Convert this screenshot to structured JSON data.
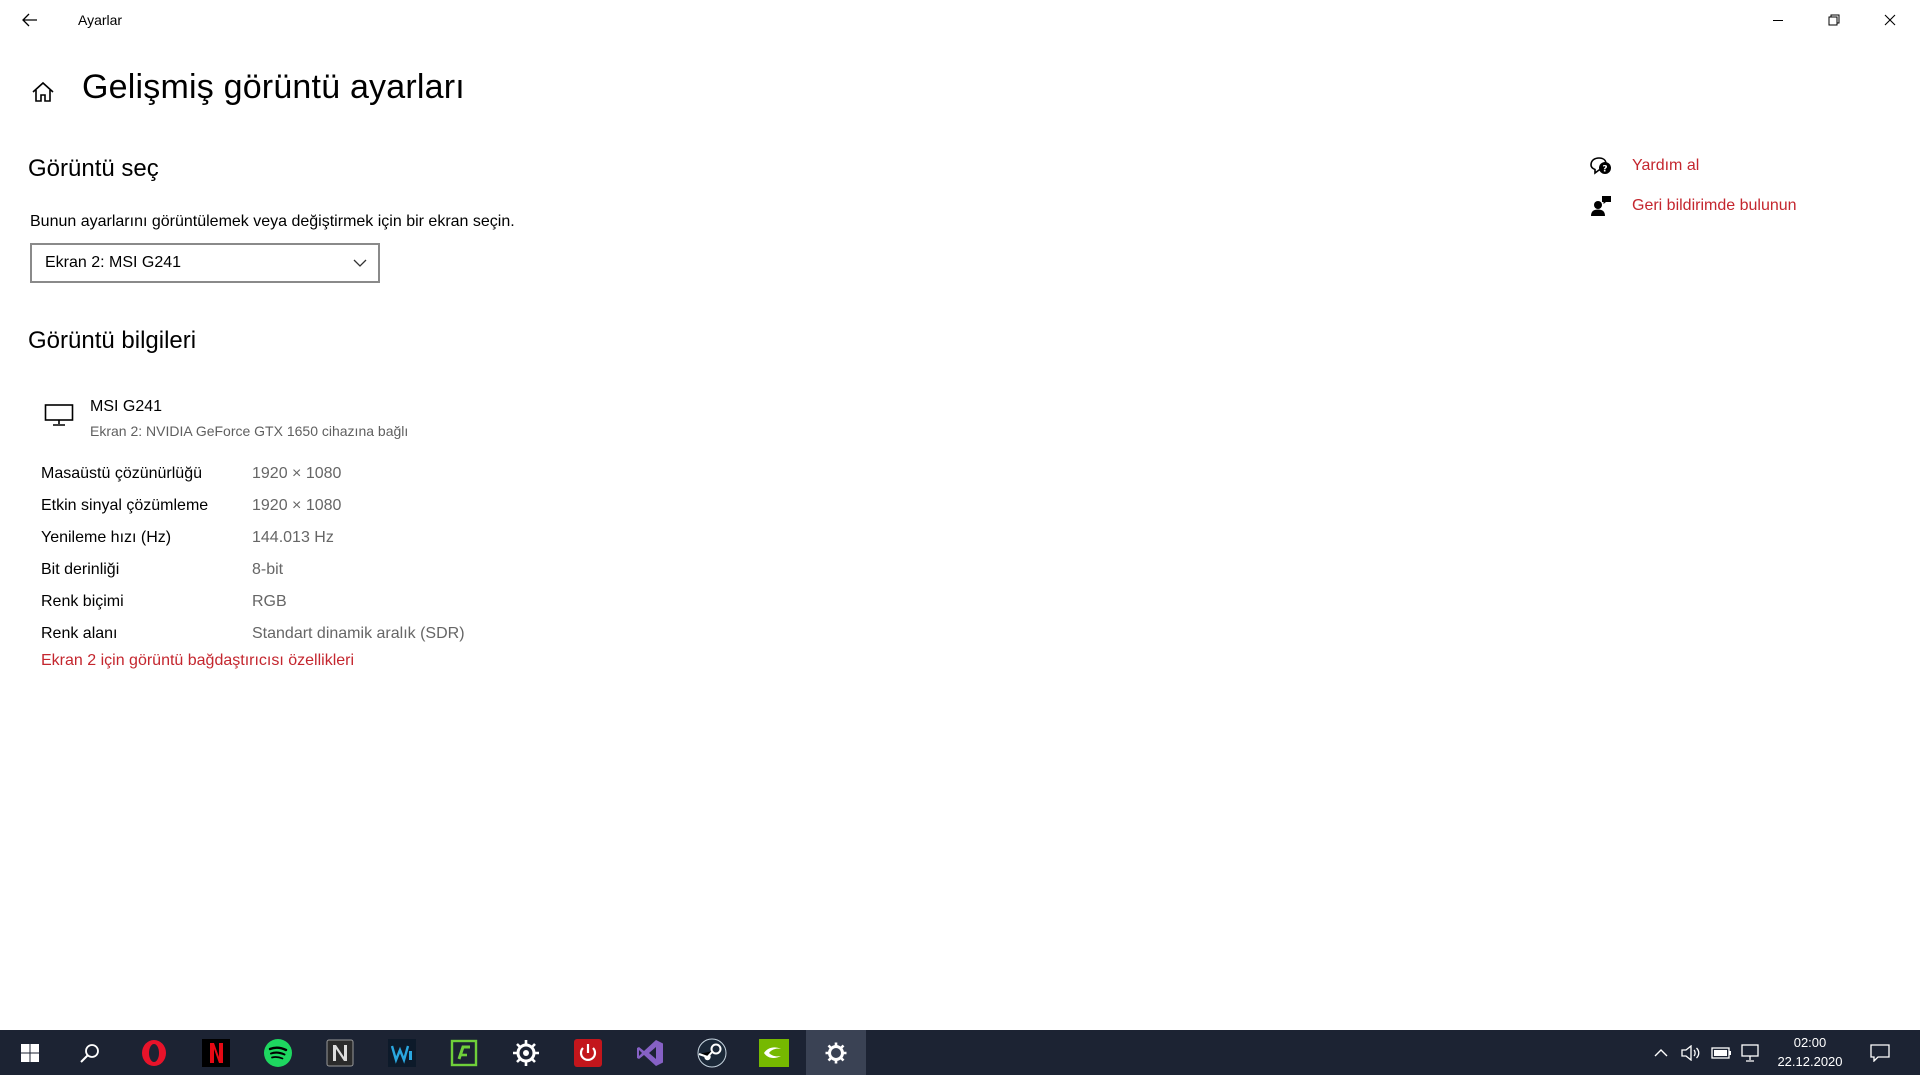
{
  "window": {
    "title": "Ayarlar"
  },
  "header": {
    "title": "Gelişmiş görüntü ayarları"
  },
  "select_display": {
    "section_title": "Görüntü seç",
    "description": "Bunun ayarlarını görüntülemek veya değiştirmek için bir ekran seçin.",
    "selected": "Ekran 2: MSI G241"
  },
  "display_info": {
    "section_title": "Görüntü bilgileri",
    "monitor_name": "MSI G241",
    "monitor_sub": "Ekran 2: NVIDIA GeForce GTX 1650 cihazına bağlı",
    "rows": [
      {
        "label": "Masaüstü çözünürlüğü",
        "value": "1920 × 1080"
      },
      {
        "label": "Etkin sinyal çözümleme",
        "value": "1920 × 1080"
      },
      {
        "label": "Yenileme hızı (Hz)",
        "value": "144.013 Hz"
      },
      {
        "label": "Bit derinliği",
        "value": "8-bit"
      },
      {
        "label": "Renk biçimi",
        "value": "RGB"
      },
      {
        "label": "Renk alanı",
        "value": "Standart dinamik aralık (SDR)"
      }
    ],
    "adapter_link": "Ekran 2 için görüntü bağdaştırıcısı özellikleri"
  },
  "help": {
    "get_help": "Yardım al",
    "feedback": "Geri bildirimde bulunun"
  },
  "colors": {
    "accent": "#c4262e",
    "taskbar": "#1c2333"
  },
  "taskbar": {
    "time": "02:00",
    "date": "22.12.2020",
    "apps": [
      "windows-start",
      "search",
      "opera",
      "netflix",
      "spotify",
      "notion",
      "waves",
      "app-green",
      "steelseries",
      "power-app",
      "visual-studio",
      "steam",
      "nvidia",
      "settings"
    ]
  }
}
